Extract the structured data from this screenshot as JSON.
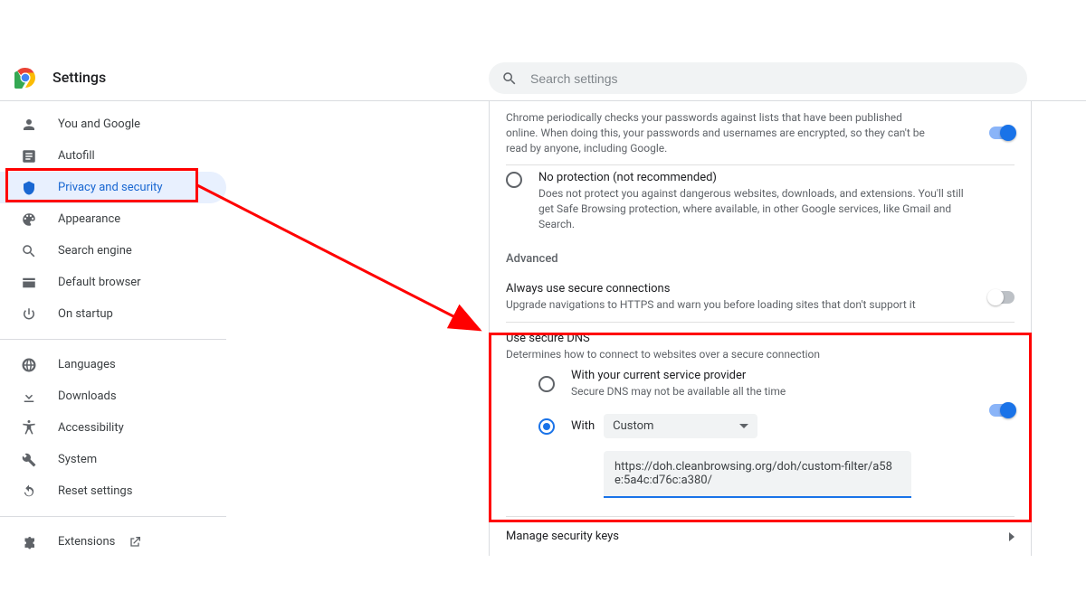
{
  "header": {
    "title": "Settings"
  },
  "search": {
    "placeholder": "Search settings"
  },
  "sidebar": {
    "items": [
      {
        "label": "You and Google",
        "icon": "person"
      },
      {
        "label": "Autofill",
        "icon": "autofill"
      },
      {
        "label": "Privacy and security",
        "icon": "shield",
        "selected": true
      },
      {
        "label": "Appearance",
        "icon": "palette"
      },
      {
        "label": "Search engine",
        "icon": "search"
      },
      {
        "label": "Default browser",
        "icon": "browser"
      },
      {
        "label": "On startup",
        "icon": "power"
      }
    ],
    "items2": [
      {
        "label": "Languages",
        "icon": "globe"
      },
      {
        "label": "Downloads",
        "icon": "download"
      },
      {
        "label": "Accessibility",
        "icon": "accessibility"
      },
      {
        "label": "System",
        "icon": "wrench"
      },
      {
        "label": "Reset settings",
        "icon": "reset"
      }
    ],
    "items3": [
      {
        "label": "Extensions",
        "icon": "extension",
        "external": true
      }
    ]
  },
  "content": {
    "password_check": {
      "description": "Chrome periodically checks your passwords against lists that have been published online. When doing this, your passwords and usernames are encrypted, so they can't be read by anyone, including Google.",
      "toggle_on": true
    },
    "no_protection": {
      "title": "No protection (not recommended)",
      "description": "Does not protect you against dangerous websites, downloads, and extensions. You'll still get Safe Browsing protection, where available, in other Google services, like Gmail and Search.",
      "selected": false
    },
    "advanced_label": "Advanced",
    "always_secure": {
      "title": "Always use secure connections",
      "description": "Upgrade navigations to HTTPS and warn you before loading sites that don't support it",
      "toggle_on": false
    },
    "secure_dns": {
      "title": "Use secure DNS",
      "description": "Determines how to connect to websites over a secure connection",
      "toggle_on": true,
      "option_current": {
        "title": "With your current service provider",
        "sub": "Secure DNS may not be available all the time",
        "selected": false
      },
      "option_custom": {
        "label": "With",
        "dropdown_value": "Custom",
        "selected": true,
        "url_value": "https://doh.cleanbrowsing.org/doh/custom-filter/a58e:5a4c:d76c:a380/"
      }
    },
    "manage_keys": "Manage security keys"
  }
}
